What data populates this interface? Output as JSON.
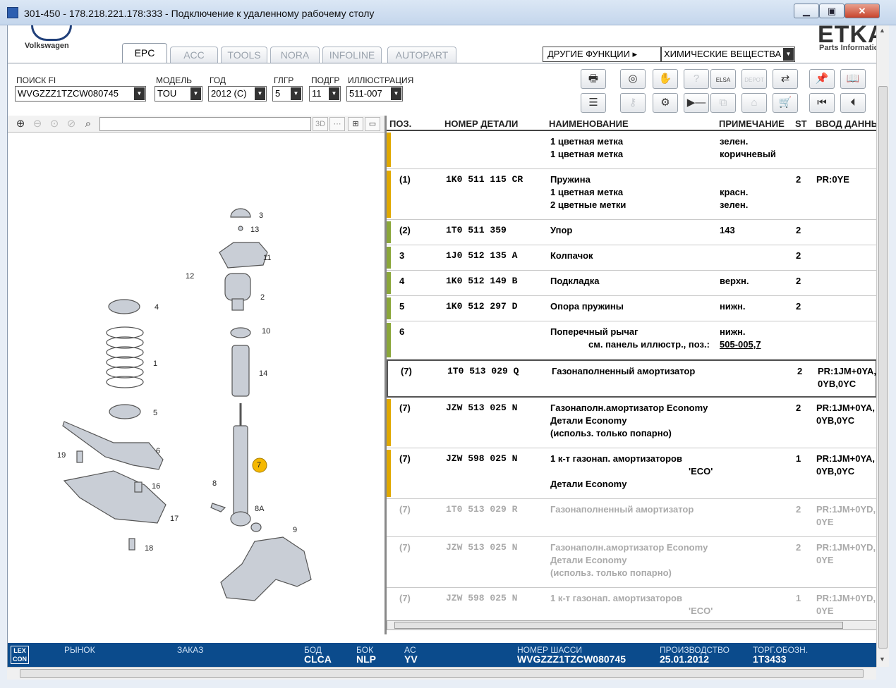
{
  "window": {
    "title": "301-450 - 178.218.221.178:333 - Подключение к удаленному рабочему столу"
  },
  "brand": {
    "vw": "Volkswagen",
    "etka": "ETKA",
    "etka_sub": "Parts Information"
  },
  "tabs": [
    "EPC",
    "ACC",
    "TOOLS",
    "NORA",
    "INFOLINE",
    "AUTOPART"
  ],
  "functions": {
    "other": "ДРУГИЕ ФУНКЦИИ ▸",
    "chem": "ХИМИЧЕСКИЕ ВЕЩЕСТВА"
  },
  "filters": {
    "search_label": "ПОИСК FI",
    "search_value": "WVGZZZ1TZCW080745",
    "model_label": "МОДЕЛЬ",
    "model_value": "TOU",
    "year_label": "ГОД",
    "year_value": "2012 (C)",
    "glgr_label": "ГЛГР",
    "glgr_value": "5",
    "podgr_label": "ПОДГР",
    "podgr_value": "11",
    "illus_label": "ИЛЛЮСТРАЦИЯ",
    "illus_value": "511-007"
  },
  "toolbar_buttons": [
    {
      "name": "print",
      "icon": "🖶"
    },
    {
      "name": "disk",
      "icon": "◎"
    },
    {
      "name": "hands",
      "icon": "✋"
    },
    {
      "name": "search-disabled",
      "icon": "?"
    },
    {
      "name": "elsa",
      "icon": "ELSA"
    },
    {
      "name": "depot",
      "icon": "DEPOT"
    },
    {
      "name": "cart-transfer",
      "icon": "⇄"
    },
    {
      "name": "pin",
      "icon": "📌"
    },
    {
      "name": "book",
      "icon": "📖"
    },
    {
      "name": "list",
      "icon": "☰"
    },
    {
      "name": "key",
      "icon": "⚷"
    },
    {
      "name": "bike",
      "icon": "⚙"
    },
    {
      "name": "play-minus",
      "icon": "▶—"
    },
    {
      "name": "copy",
      "icon": "⧉"
    },
    {
      "name": "dealer",
      "icon": "⌂"
    },
    {
      "name": "cart",
      "icon": "🛒"
    },
    {
      "name": "first",
      "icon": "⏮"
    },
    {
      "name": "prev",
      "icon": "⏴"
    }
  ],
  "zoom": {
    "3d": "3D"
  },
  "columns": {
    "pos": "ПОЗ.",
    "part": "НОМЕР ДЕТАЛИ",
    "name": "НАИМЕНОВАНИЕ",
    "note": "ПРИМЕЧАНИЕ",
    "st": "ST",
    "input": "ВВОД ДАННЫХ"
  },
  "rows": [
    {
      "pos": "",
      "part": "",
      "names": [
        "1 цветная метка",
        "1 цветная метка"
      ],
      "notes": [
        "зелен.",
        "коричневый"
      ],
      "st": "",
      "input": [
        "",
        ""
      ],
      "bar": "#e0a800",
      "grey": false
    },
    {
      "pos": "(1)",
      "part": "1K0 511 115 CR",
      "names": [
        "Пружина",
        "1 цветная метка",
        "2 цветные метки"
      ],
      "notes": [
        "",
        "красн.",
        "зелен."
      ],
      "st": "2",
      "input": [
        "PR:0YE"
      ],
      "bar": "#e0a800",
      "grey": false
    },
    {
      "pos": "(2)",
      "part": "1T0 511 359",
      "names": [
        "Упор"
      ],
      "notes": [
        "143"
      ],
      "st": "2",
      "input": [
        ""
      ],
      "bar": "#8aa63a",
      "grey": false
    },
    {
      "pos": "3",
      "part": "1J0 512 135 A",
      "names": [
        "Колпачок"
      ],
      "notes": [
        ""
      ],
      "st": "2",
      "input": [
        ""
      ],
      "bar": "#8aa63a",
      "grey": false
    },
    {
      "pos": "4",
      "part": "1K0 512 149 B",
      "names": [
        "Подкладка"
      ],
      "notes": [
        "верхн."
      ],
      "st": "2",
      "input": [
        ""
      ],
      "bar": "#8aa63a",
      "grey": false
    },
    {
      "pos": "5",
      "part": "1K0 512 297 D",
      "names": [
        "Опора пружины"
      ],
      "notes": [
        "нижн."
      ],
      "st": "2",
      "input": [
        ""
      ],
      "bar": "#8aa63a",
      "grey": false
    },
    {
      "pos": "6",
      "part": "",
      "names": [
        "Поперечный рычаг",
        "см. панель иллюстр., поз.:"
      ],
      "notes": [
        "нижн.",
        "505-005,7"
      ],
      "st": "",
      "input": [
        ""
      ],
      "bar": "#8aa63a",
      "grey": false
    },
    {
      "pos": "(7)",
      "part": "1T0 513 029 Q",
      "names": [
        "Газонаполненный амортизатор"
      ],
      "notes": [
        ""
      ],
      "st": "2",
      "input": [
        "PR:1JM+0YA,",
        "0YB,0YC"
      ],
      "bar": "",
      "grey": false
    },
    {
      "pos": "(7)",
      "part": "JZW 513 025 N",
      "names": [
        "Газонаполн.амортизатор Economy",
        "Детали Economy",
        "(использ. только попарно)"
      ],
      "notes": [
        ""
      ],
      "st": "2",
      "input": [
        "PR:1JM+0YA,",
        "0YB,0YC"
      ],
      "bar": "#e0a800",
      "grey": false
    },
    {
      "pos": "(7)",
      "part": "JZW 598 025 N",
      "names": [
        "1 к-т газонап. амортизаторов",
        "'ECO'",
        "Детали Economy"
      ],
      "notes": [
        ""
      ],
      "st": "1",
      "input": [
        "PR:1JM+0YA,",
        "0YB,0YC"
      ],
      "bar": "#e0a800",
      "grey": false
    },
    {
      "pos": "(7)",
      "part": "1T0 513 029 R",
      "names": [
        "Газонаполненный амортизатор"
      ],
      "notes": [
        ""
      ],
      "st": "2",
      "input": [
        "PR:1JM+0YD,",
        "0YE"
      ],
      "bar": "",
      "grey": true
    },
    {
      "pos": "(7)",
      "part": "JZW 513 025 N",
      "names": [
        "Газонаполн.амортизатор Economy",
        "Детали Economy",
        "(использ. только попарно)"
      ],
      "notes": [
        ""
      ],
      "st": "2",
      "input": [
        "PR:1JM+0YD,",
        "0YE"
      ],
      "bar": "",
      "grey": true
    },
    {
      "pos": "(7)",
      "part": "JZW 598 025 N",
      "names": [
        "1 к-т газонап. амортизаторов",
        "'ECO'",
        "Детали Economy"
      ],
      "notes": [
        ""
      ],
      "st": "1",
      "input": [
        "PR:1JM+0YD,",
        "0YE"
      ],
      "bar": "",
      "grey": true
    }
  ],
  "callouts": [
    "3",
    "13",
    "11",
    "12",
    "2",
    "4",
    "10",
    "1",
    "14",
    "5",
    "6",
    "19",
    "16",
    "7",
    "8",
    "8A",
    "17",
    "9",
    "18"
  ],
  "status": {
    "logo": "LEX CON",
    "market_label": "РЫНОК",
    "order_label": "ЗАКАЗ",
    "bod_label": "БОД",
    "bod_value": "CLCA",
    "bok_label": "БОК",
    "bok_value": "NLP",
    "ac_label": "AC",
    "ac_value": "YV",
    "chassis_label": "НОМЕР ШАССИ",
    "chassis_value": "WVGZZZ1TZCW080745",
    "prod_label": "ПРОИЗВОДСТВО",
    "prod_value": "25.01.2012",
    "trade_label": "ТОРГ.ОБОЗН.",
    "trade_value": "1T3433"
  },
  "colors": {
    "status_bg": "#0b4b8c",
    "bar_yellow": "#e0a800",
    "bar_green": "#8aa63a",
    "callout_highlight": "#f5b800"
  }
}
